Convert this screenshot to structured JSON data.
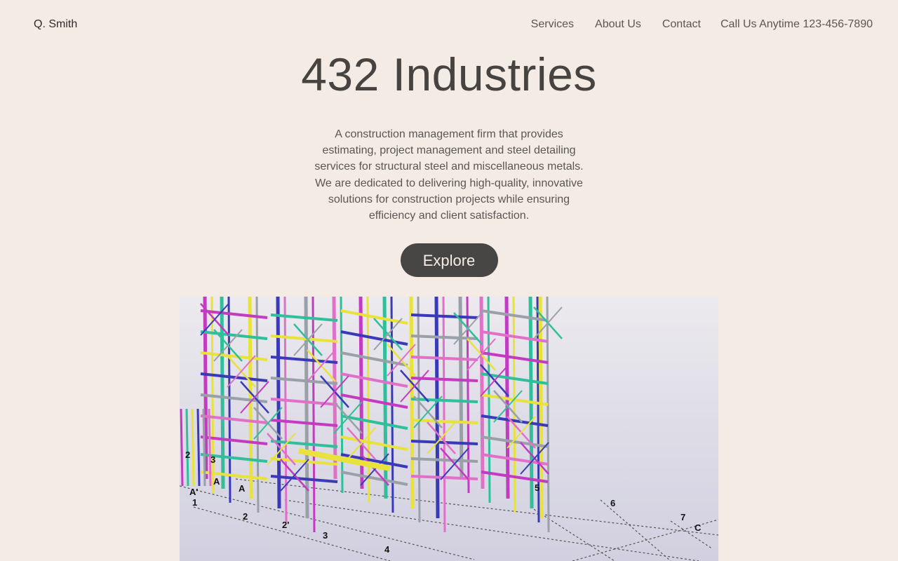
{
  "header": {
    "brand": "Q. Smith",
    "nav": [
      {
        "label": "Services"
      },
      {
        "label": "About Us"
      },
      {
        "label": "Contact"
      },
      {
        "label": "Call Us Anytime 123-456-7890"
      }
    ]
  },
  "hero": {
    "title": "432 Industries",
    "description": "A construction management firm that provides estimating, project management and steel detailing services for structural steel and miscellaneous metals. We are dedicated to delivering high-quality, innovative solutions for construction projects while ensuring efficiency and client satisfaction.",
    "cta_label": "Explore"
  },
  "illustration": {
    "subject": "3D steel structure model",
    "grid_labels": [
      "2",
      "3",
      "A'",
      "1",
      "A",
      "A",
      "2",
      "2'",
      "3",
      "4",
      "5",
      "6",
      "7",
      "C"
    ],
    "colors": {
      "magenta": "#c23bc0",
      "teal": "#2fbf9a",
      "yellow": "#e8e23a",
      "blue": "#3a3ab8",
      "grey": "#9aa0a8",
      "pink": "#e070c8"
    }
  }
}
